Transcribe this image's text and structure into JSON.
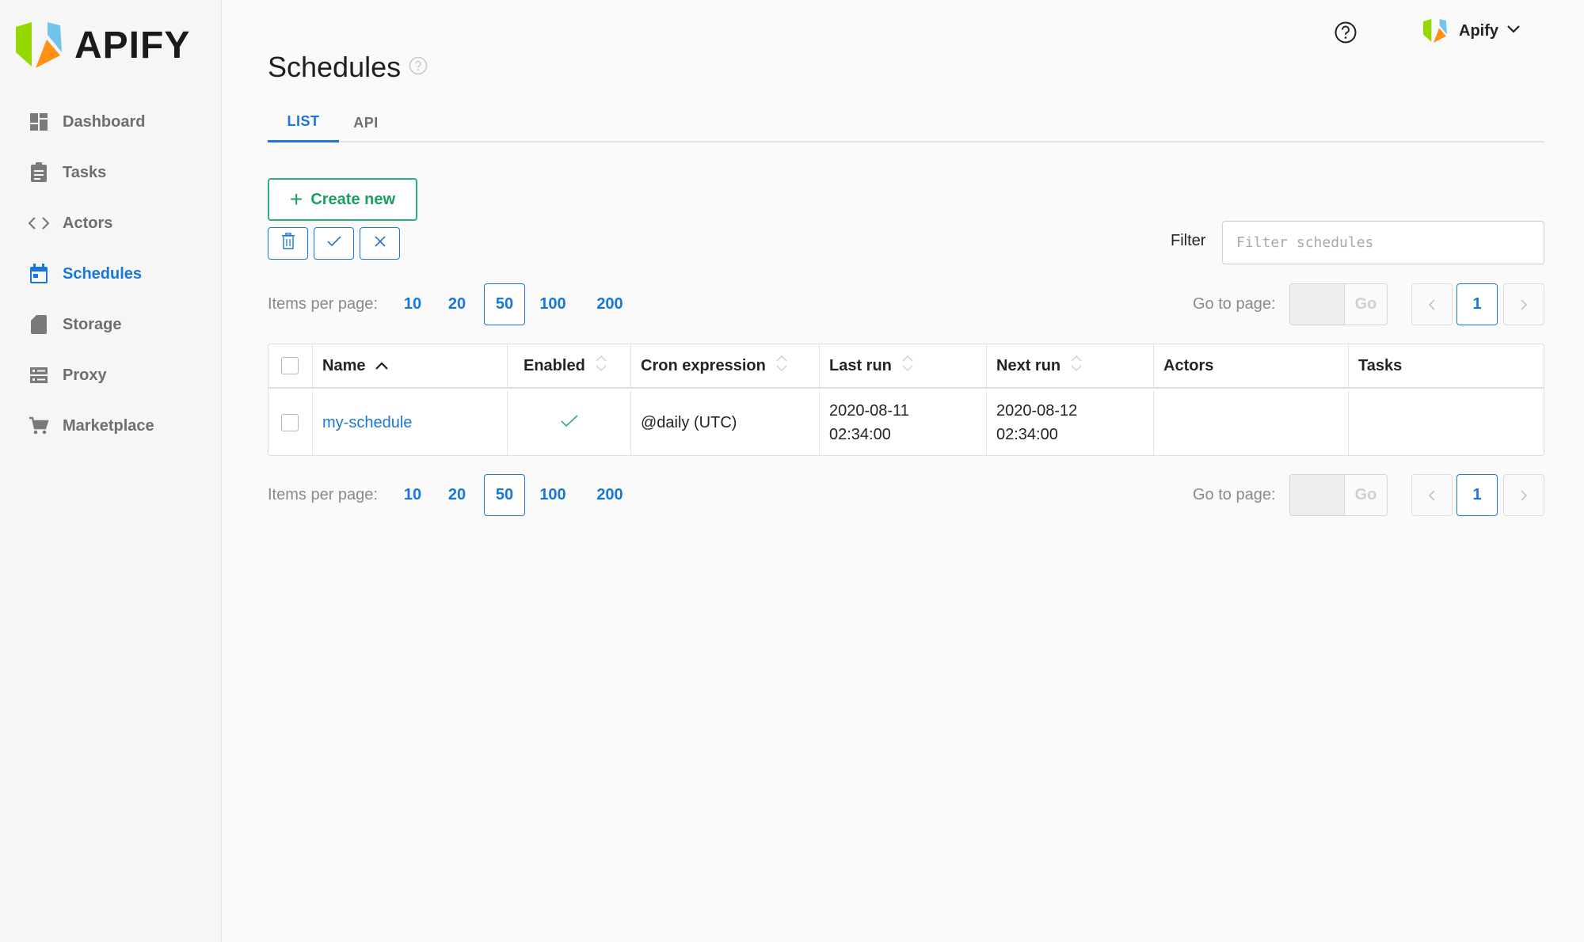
{
  "brand": {
    "name": "APIFY"
  },
  "sidebar": {
    "items": [
      {
        "label": "Dashboard",
        "icon": "dashboard-icon",
        "active": false
      },
      {
        "label": "Tasks",
        "icon": "clipboard-icon",
        "active": false
      },
      {
        "label": "Actors",
        "icon": "code-icon",
        "active": false
      },
      {
        "label": "Schedules",
        "icon": "calendar-icon",
        "active": true
      },
      {
        "label": "Storage",
        "icon": "sd-card-icon",
        "active": false
      },
      {
        "label": "Proxy",
        "icon": "server-icon",
        "active": false
      },
      {
        "label": "Marketplace",
        "icon": "cart-icon",
        "active": false
      }
    ]
  },
  "header": {
    "account_name": "Apify"
  },
  "page": {
    "title": "Schedules"
  },
  "tabs": [
    {
      "label": "LIST",
      "active": true
    },
    {
      "label": "API",
      "active": false
    }
  ],
  "toolbar": {
    "create_label": "Create new"
  },
  "filter": {
    "label": "Filter",
    "placeholder": "Filter schedules",
    "value": ""
  },
  "pagination": {
    "items_per_page_label": "Items per page:",
    "options": [
      "10",
      "20",
      "50",
      "100",
      "200"
    ],
    "selected": "50",
    "goto_label": "Go to page:",
    "go_label": "Go",
    "current_page": "1"
  },
  "table": {
    "columns": [
      {
        "label": "Name",
        "sort": "asc"
      },
      {
        "label": "Enabled",
        "sort": "none"
      },
      {
        "label": "Cron expression",
        "sort": "none"
      },
      {
        "label": "Last run",
        "sort": "none"
      },
      {
        "label": "Next run",
        "sort": "none"
      },
      {
        "label": "Actors",
        "sort": null
      },
      {
        "label": "Tasks",
        "sort": null
      }
    ],
    "rows": [
      {
        "name": "my-schedule",
        "enabled": true,
        "cron": "@daily (UTC)",
        "last_run_date": "2020-08-11",
        "last_run_time": "02:34:00",
        "next_run_date": "2020-08-12",
        "next_run_time": "02:34:00",
        "actors": "",
        "tasks": ""
      }
    ]
  },
  "colors": {
    "accent": "#1877d8",
    "success": "#2bb27a",
    "muted": "#6e6e6e"
  }
}
